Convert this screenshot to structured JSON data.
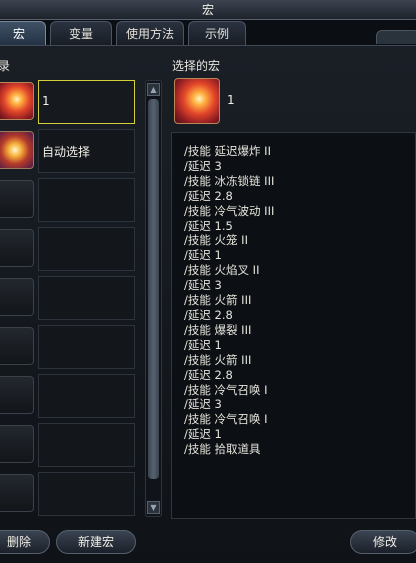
{
  "window": {
    "title": "宏"
  },
  "tabs": [
    {
      "label": "宏",
      "active": true
    },
    {
      "label": "变量"
    },
    {
      "label": "使用方法"
    },
    {
      "label": "示例"
    }
  ],
  "left_panel": {
    "label": "录",
    "slots": [
      {
        "name": "1",
        "icon": "fire-burst-icon",
        "selected": true
      },
      {
        "name": "自动选择",
        "icon": "star-pentagram-icon"
      },
      {
        "name": ""
      },
      {
        "name": ""
      },
      {
        "name": ""
      },
      {
        "name": ""
      },
      {
        "name": ""
      },
      {
        "name": ""
      },
      {
        "name": ""
      },
      {
        "name": ""
      }
    ]
  },
  "right_panel": {
    "label": "选择的宏",
    "selected_name": "1",
    "selected_icon": "fire-burst-icon",
    "script_lines": [
      "/技能 延迟爆炸 II",
      "/延迟 3",
      "/技能 冰冻锁链 III",
      "/延迟 2.8",
      "/技能 冷气波动 III",
      "/延迟 1.5",
      "/技能 火笼 II",
      "/延迟 1",
      "/技能 火焰叉 II",
      "/延迟 3",
      "/技能 火箭 III",
      "/延迟 2.8",
      "/技能 爆裂 III",
      "/延迟 1",
      "/技能 火箭 III",
      "/延迟 2.8",
      "/技能 冷气召唤 I",
      "/延迟 3",
      "/技能 冷气召唤 I",
      "/延迟 1",
      "/技能 拾取道具"
    ]
  },
  "buttons": {
    "delete": "删除",
    "new": "新建宏",
    "edit": "修改"
  },
  "colors": {
    "selected_border": "#d4ce3a",
    "accent": "#3f5165"
  }
}
